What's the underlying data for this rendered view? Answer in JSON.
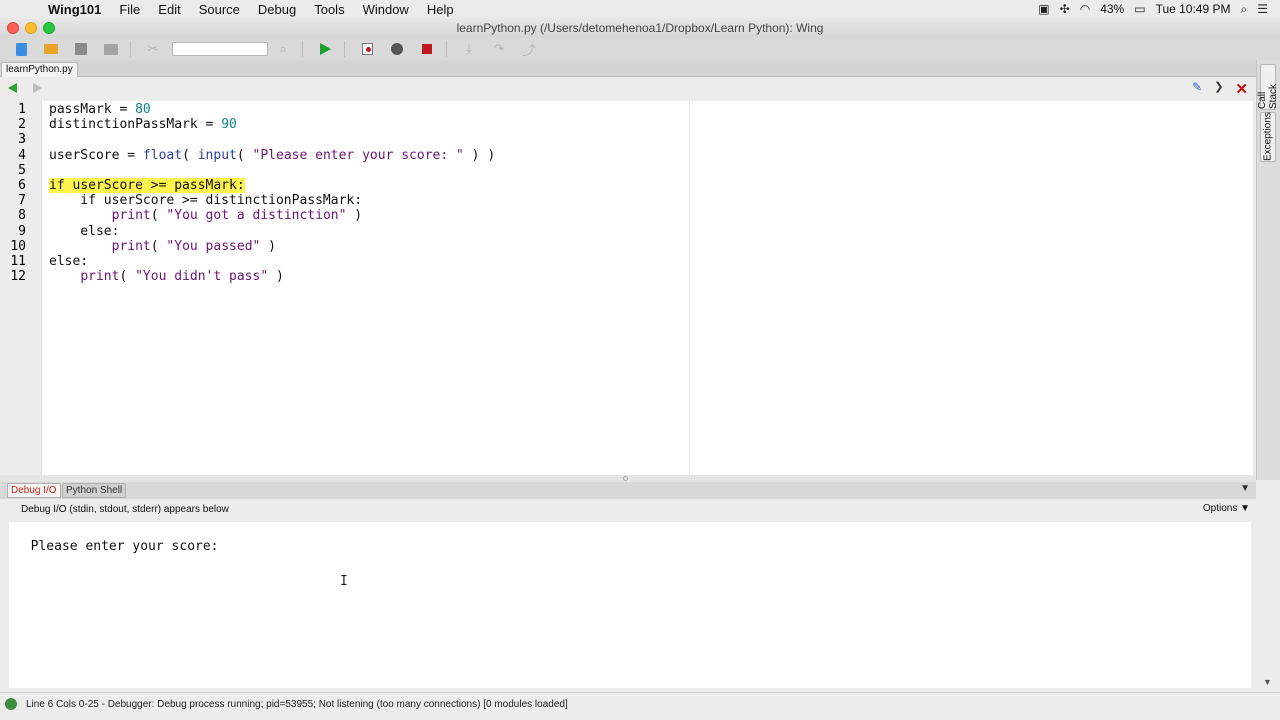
{
  "menubar": {
    "app": "Wing101",
    "items": [
      "File",
      "Edit",
      "Source",
      "Debug",
      "Tools",
      "Window",
      "Help"
    ],
    "battery": "43%",
    "clock": "Tue 10:49 PM"
  },
  "window": {
    "title": "learnPython.py (/Users/detomehenoa1/Dropbox/Learn Python): Wing"
  },
  "editor": {
    "tab": "learnPython.py",
    "current_line": 6,
    "lines": [
      {
        "n": "1",
        "parts": [
          {
            "t": "passMark = ",
            "c": "kw"
          },
          {
            "t": "80",
            "c": "num"
          }
        ]
      },
      {
        "n": "2",
        "parts": [
          {
            "t": "distinctionPassMark = ",
            "c": "kw"
          },
          {
            "t": "90",
            "c": "num"
          }
        ]
      },
      {
        "n": "3",
        "parts": []
      },
      {
        "n": "4",
        "parts": [
          {
            "t": "userScore = ",
            "c": "kw"
          },
          {
            "t": "float",
            "c": "fn"
          },
          {
            "t": "( ",
            "c": "kw"
          },
          {
            "t": "input",
            "c": "fn"
          },
          {
            "t": "( ",
            "c": "kw"
          },
          {
            "t": "\"Please enter your score: \"",
            "c": "str"
          },
          {
            "t": " ) )",
            "c": "kw"
          }
        ]
      },
      {
        "n": "5",
        "parts": []
      },
      {
        "n": "6",
        "parts": [
          {
            "t": "if userScore >= passMark:",
            "c": "kw"
          }
        ]
      },
      {
        "n": "7",
        "parts": [
          {
            "t": "    if userScore >= distinctionPassMark:",
            "c": "kw"
          }
        ]
      },
      {
        "n": "8",
        "parts": [
          {
            "t": "        ",
            "c": "kw"
          },
          {
            "t": "print",
            "c": "str"
          },
          {
            "t": "( ",
            "c": "kw"
          },
          {
            "t": "\"You got a distinction\"",
            "c": "str"
          },
          {
            "t": " )",
            "c": "kw"
          }
        ]
      },
      {
        "n": "9",
        "parts": [
          {
            "t": "    else:",
            "c": "kw"
          }
        ]
      },
      {
        "n": "10",
        "parts": [
          {
            "t": "        ",
            "c": "kw"
          },
          {
            "t": "print",
            "c": "str"
          },
          {
            "t": "( ",
            "c": "kw"
          },
          {
            "t": "\"You passed\"",
            "c": "str"
          },
          {
            "t": " )",
            "c": "kw"
          }
        ]
      },
      {
        "n": "11",
        "parts": [
          {
            "t": "else:",
            "c": "kw"
          }
        ]
      },
      {
        "n": "12",
        "parts": [
          {
            "t": "    ",
            "c": "kw"
          },
          {
            "t": "print",
            "c": "str"
          },
          {
            "t": "( ",
            "c": "kw"
          },
          {
            "t": "\"You didn't pass\"",
            "c": "str"
          },
          {
            "t": " )",
            "c": "kw"
          }
        ]
      }
    ]
  },
  "sidebar": {
    "tabs": [
      "Call Stack",
      "Exceptions"
    ]
  },
  "panel": {
    "tabs": [
      "Debug I/O",
      "Python Shell"
    ],
    "info": "Debug I/O (stdin, stdout, stderr) appears below",
    "options": "Options ▼",
    "output": "Please enter your score: "
  },
  "status": {
    "text": "Line 6 Cols 0-25 - Debugger: Debug process running; pid=53955; Not listening (too many connections) [0 modules loaded]"
  },
  "colors": {
    "highlight": "#fff44f",
    "number": "#0f8383",
    "string": "#6b1773"
  }
}
